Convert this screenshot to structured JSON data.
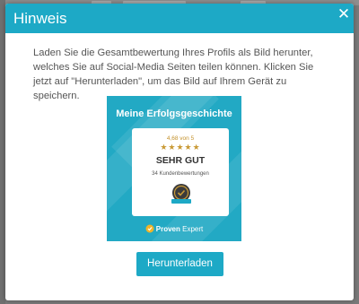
{
  "modal": {
    "title": "Hinweis",
    "close_glyph": "✕",
    "description": "Laden Sie die Gesamtbewertung Ihres Profils als Bild herunter, welches Sie auf Social-Media Seiten teilen können. Klicken Sie jetzt auf \"Herunterladen\", um das Bild auf Ihrem Gerät zu speichern.",
    "download_label": "Herunterladen"
  },
  "badge": {
    "title": "Meine Erfolgsgeschichte",
    "score_text": "4,68 von 5",
    "stars": "★★★★★",
    "rating": 4.68,
    "rating_max": 5,
    "verdict": "SEHR GUT",
    "reviews": "34 Kundenbewertungen",
    "brand_bold": "Proven",
    "brand_light": "Expert"
  },
  "colors": {
    "accent": "#1da9c6",
    "badge_bg": "#22a9c4",
    "stars": "#c99a36"
  },
  "icons": {
    "close": "close-icon",
    "seal": "award-seal-icon",
    "brand": "proven-expert-logo-icon"
  }
}
